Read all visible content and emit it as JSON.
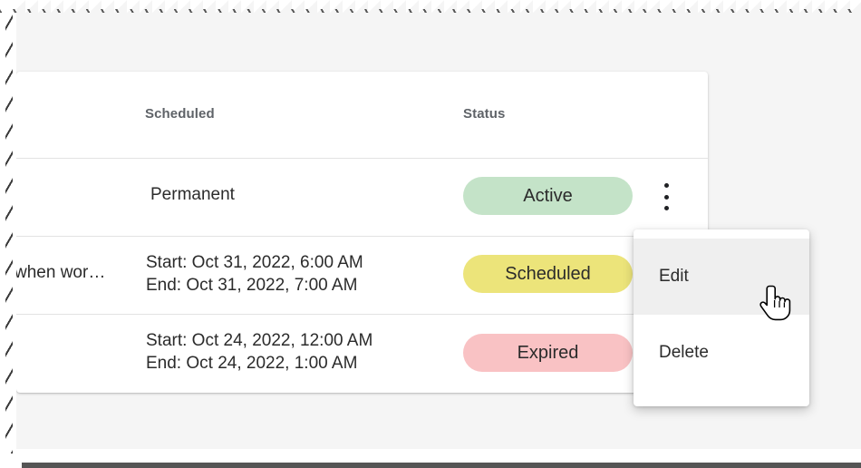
{
  "table": {
    "columns": {
      "scheduled": "Scheduled",
      "status": "Status"
    },
    "rows": [
      {
        "name": "",
        "scheduled": "Permanent",
        "status": "Active",
        "status_color": "#c4e3c8"
      },
      {
        "name": "when wor…",
        "scheduled_start": "Start: Oct 31, 2022, 6:00 AM",
        "scheduled_end": "End: Oct 31, 2022, 7:00 AM",
        "status": "Scheduled",
        "status_color": "#ece47a"
      },
      {
        "name": "",
        "scheduled_start": "Start: Oct 24, 2022, 12:00 AM",
        "scheduled_end": "End: Oct 24, 2022, 1:00 AM",
        "status": "Expired",
        "status_color": "#f9c2c4"
      }
    ]
  },
  "row_menu": {
    "items": [
      "Edit",
      "Delete"
    ],
    "hovered": "Edit"
  },
  "icons": {
    "row_actions": "more-vert-icon",
    "cursor": "hand-pointer-cursor-icon"
  }
}
